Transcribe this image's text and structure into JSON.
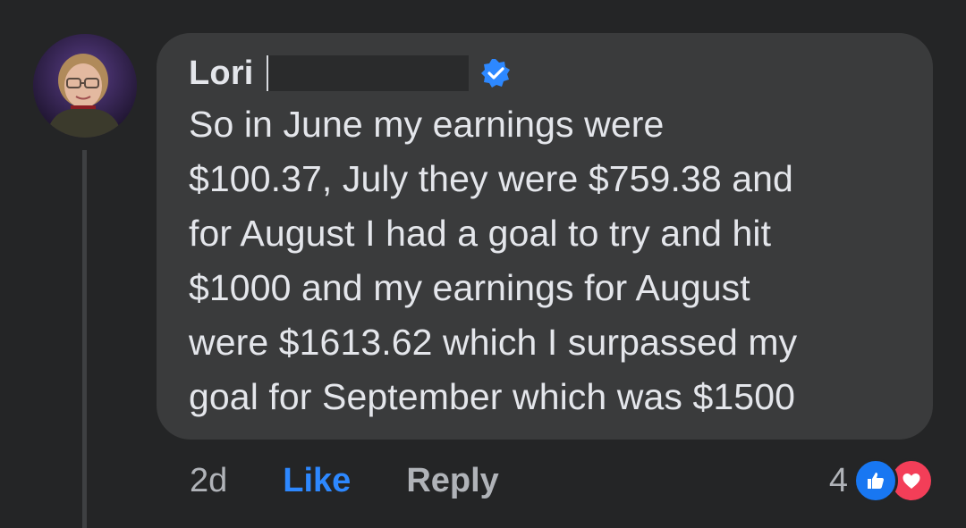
{
  "comment": {
    "author": "Lori",
    "verified": true,
    "text": "So in June my earnings were\n$100.37,  July they were $759.38 and\nfor August I had a goal to try and hit\n$1000 and my earnings for August\nwere $1613.62 which I surpassed my\ngoal for September which was $1500"
  },
  "actions": {
    "time": "2d",
    "like_label": "Like",
    "reply_label": "Reply"
  },
  "reactions": {
    "count": "4",
    "icons": [
      "like-icon",
      "love-icon"
    ]
  },
  "colors": {
    "background": "#242526",
    "bubble": "#3a3b3c",
    "like_blue": "#2d88ff",
    "love_red": "#f33e58"
  }
}
